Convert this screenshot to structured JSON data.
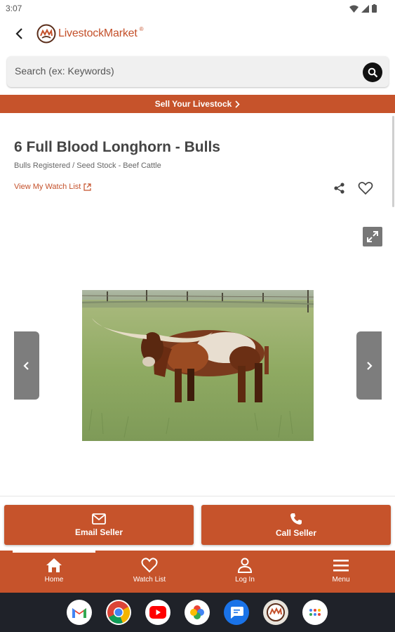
{
  "status_bar": {
    "time": "3:07"
  },
  "header": {
    "logo_text": "LivestockMarket",
    "logo_reg": "®"
  },
  "search": {
    "placeholder": "Search (ex: Keywords)"
  },
  "banner": {
    "sell_label": "Sell Your Livestock"
  },
  "listing": {
    "title": "6 Full Blood Longhorn - Bulls",
    "category": "Bulls Registered / Seed Stock - Beef Cattle",
    "watch_link": "View My Watch List"
  },
  "actions": {
    "email_label": "Email Seller",
    "call_label": "Call Seller"
  },
  "bottom_nav": {
    "items": [
      {
        "label": "Home",
        "icon": "home-icon"
      },
      {
        "label": "Watch List",
        "icon": "heart-icon"
      },
      {
        "label": "Log In",
        "icon": "person-icon"
      },
      {
        "label": "Menu",
        "icon": "hamburger-icon"
      }
    ]
  },
  "dock": {
    "apps": [
      "gmail",
      "chrome",
      "youtube",
      "photos",
      "messages",
      "livestockmarket",
      "apps-grid"
    ]
  },
  "colors": {
    "brand": "#c6532b",
    "dock_bg": "#1f2229"
  }
}
